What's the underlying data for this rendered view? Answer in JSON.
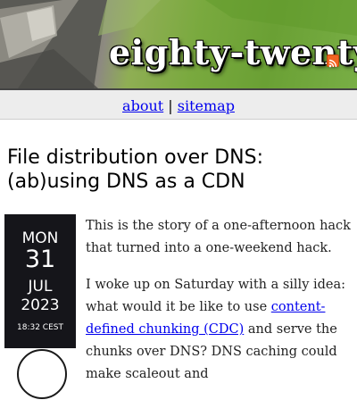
{
  "site": {
    "title": "eighty-twenty",
    "rss_icon": "rss-feed-icon"
  },
  "nav": {
    "about": "about",
    "separator": "|",
    "sitemap": "sitemap"
  },
  "post": {
    "title": "File distribution over DNS: (ab)using DNS as a CDN",
    "date": {
      "weekday": "MON",
      "day": "31",
      "month": "JUL",
      "year": "2023",
      "time": "18:32 CEST"
    },
    "paragraph1": "This is the story of a one-afternoon hack that turned into a one-weekend hack.",
    "paragraph2_before": "I woke up on Saturday with a silly idea: what would it be like to use ",
    "paragraph2_link": "content-defined chunking (CDC)",
    "paragraph2_after": " and serve the chunks over DNS? DNS caching could make scaleout and"
  },
  "colors": {
    "link": "#0000ee",
    "date_badge_bg": "#15151a",
    "rss": "#f26522"
  }
}
